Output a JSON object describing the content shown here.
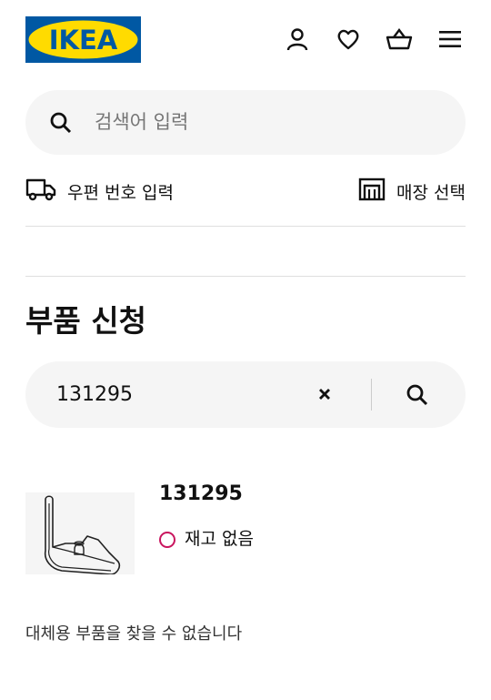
{
  "header": {
    "logo_text": "IKEA",
    "icons": [
      "account-icon",
      "heart-icon",
      "basket-icon",
      "menu-icon"
    ]
  },
  "search": {
    "placeholder": "검색어 입력"
  },
  "location": {
    "postcode_label": "우편 번호 입력",
    "store_label": "매장 선택"
  },
  "page": {
    "title": "부품 신청"
  },
  "part_search": {
    "value": "131295"
  },
  "result": {
    "part_number": "131295",
    "stock_status": "재고 없음",
    "stock_color": "#c9155e"
  },
  "message": {
    "no_replacement": "대체용 부품을 찾을 수 없습니다"
  },
  "colors": {
    "brand_blue": "#0058a3",
    "brand_yellow": "#ffdb00",
    "field_bg": "#f5f5f5"
  }
}
